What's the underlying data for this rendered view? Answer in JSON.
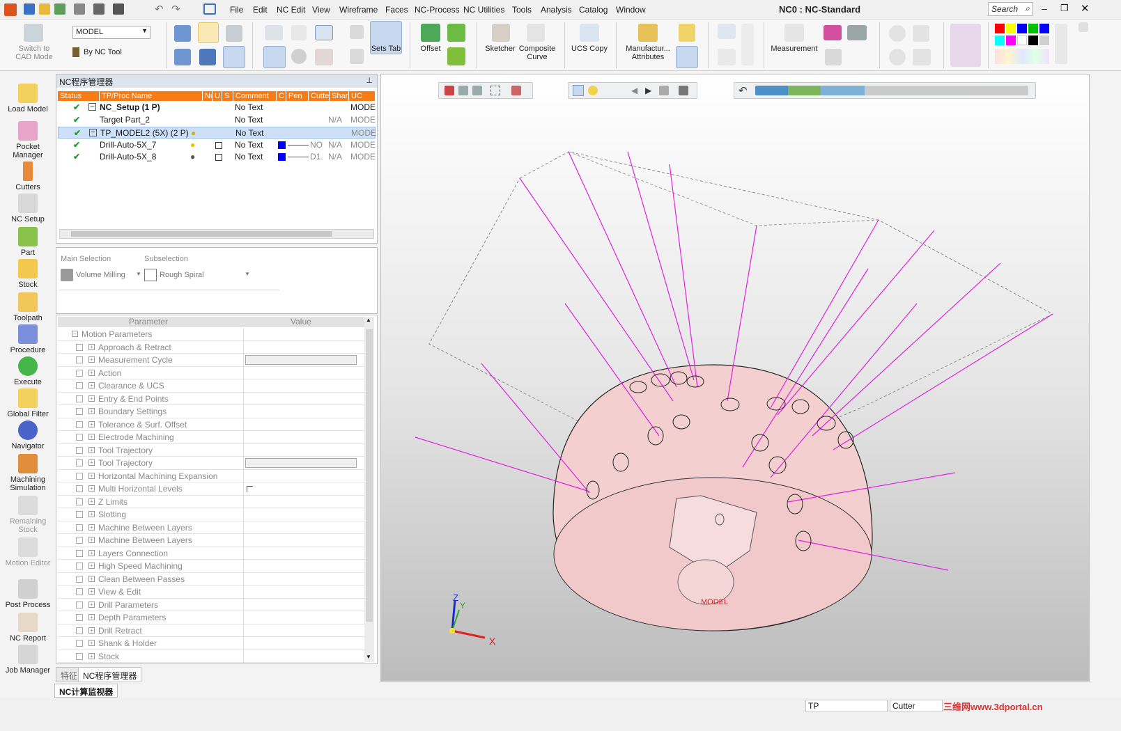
{
  "title": {
    "app_title": "NC0 : NC-Standard",
    "search_placeholder": "Search"
  },
  "menu": [
    "File",
    "Edit",
    "NC Edit",
    "View",
    "Wireframe",
    "Faces",
    "NC-Process",
    "NC Utilities",
    "Tools",
    "Analysis",
    "Catalog",
    "Window"
  ],
  "ribbon": {
    "switch_cad": "Switch to CAD Mode",
    "model_select": "MODEL",
    "by_nc_tool": "By NC Tool",
    "sets_tab": "Sets Tab",
    "offset": "Offset",
    "sketcher": "Sketcher",
    "composite_curve": "Composite Curve",
    "ucs_copy": "UCS Copy",
    "manufacturing_attributes": "Manufactur... Attributes",
    "measurement": "Measurement"
  },
  "palette": [
    "#ff0000",
    "#ffff00",
    "#0000ff",
    "#00c000",
    "#0000ff",
    "#00ffff",
    "#ff00ff",
    "#ffffff",
    "#000000",
    "#e0e0e0"
  ],
  "leftbar": [
    {
      "label": "Switch to CAD Mode",
      "disabled": true
    },
    {
      "label": "Load Model"
    },
    {
      "label": "Pocket Manager"
    },
    {
      "label": "Cutters"
    },
    {
      "label": "NC Setup"
    },
    {
      "label": "Part"
    },
    {
      "label": "Stock"
    },
    {
      "label": "Toolpath"
    },
    {
      "label": "Procedure"
    },
    {
      "label": "Execute"
    },
    {
      "label": "Global Filter"
    },
    {
      "label": "Navigator"
    },
    {
      "label": "Machining Simulation"
    },
    {
      "label": "Remaining Stock",
      "disabled": true
    },
    {
      "label": "Motion Editor",
      "disabled": true
    },
    {
      "label": "Post Process"
    },
    {
      "label": "NC Report"
    },
    {
      "label": "Job Manager"
    }
  ],
  "nc_manager": {
    "title": "NC程序管理器",
    "columns": [
      "Status",
      "TP/Proc Name",
      "Nu",
      "U",
      "S",
      "Comment",
      "C",
      "Pen",
      "Cutte",
      "Shar",
      "UC"
    ],
    "rows": [
      {
        "name": "NC_Setup (1 P)",
        "comment": "No Text",
        "uc": "MODE",
        "bold": true
      },
      {
        "name": "Target Part_2",
        "comment": "No Text",
        "shar": "N/A",
        "uc": "MODE"
      },
      {
        "name": "TP_MODEL2 (5X) (2 P)",
        "comment": "No Text",
        "uc": "MODE",
        "selected": true
      },
      {
        "name": "Drill-Auto-5X_7",
        "comment": "No Text",
        "pen": "NO",
        "shar": "N/A",
        "uc": "MODE"
      },
      {
        "name": "Drill-Auto-5X_8",
        "comment": "No Text",
        "pen": "D1.",
        "shar": "N/A",
        "uc": "MODE"
      }
    ]
  },
  "selection": {
    "main_label": "Main Selection",
    "main_value": "Volume Milling",
    "sub_label": "Subselection",
    "sub_value": "Rough Spiral"
  },
  "params": {
    "header_param": "Parameter",
    "header_value": "Value",
    "rows": [
      "Motion Parameters",
      "Approach & Retract",
      "Measurement Cycle",
      "Action",
      "Clearance & UCS",
      "Entry & End Points",
      "Boundary Settings",
      "Tolerance & Surf. Offset",
      "Electrode Machining",
      "Tool Trajectory",
      "Tool Trajectory",
      "Horizontal Machining Expansion",
      "Multi Horizontal Levels",
      "Z Limits",
      "Slotting",
      "Machine Between Layers",
      "Machine Between Layers",
      "Layers Connection",
      "High Speed Machining",
      "Clean Between Passes",
      "View & Edit",
      "Drill Parameters",
      "Depth Parameters",
      "Drill Retract",
      "Shank & Holder",
      "Stock"
    ]
  },
  "tabs": {
    "features": "特征",
    "nc_manager": "NC程序管理器",
    "nc_monitor": "NC计算监视器"
  },
  "viewport": {
    "model_label": "MODEL",
    "axis_x": "X",
    "axis_y": "Y",
    "axis_z": "Z"
  },
  "status": {
    "tp": "TP",
    "cutter": "Cutter",
    "watermark": "三维网www.3dportal.cn"
  }
}
